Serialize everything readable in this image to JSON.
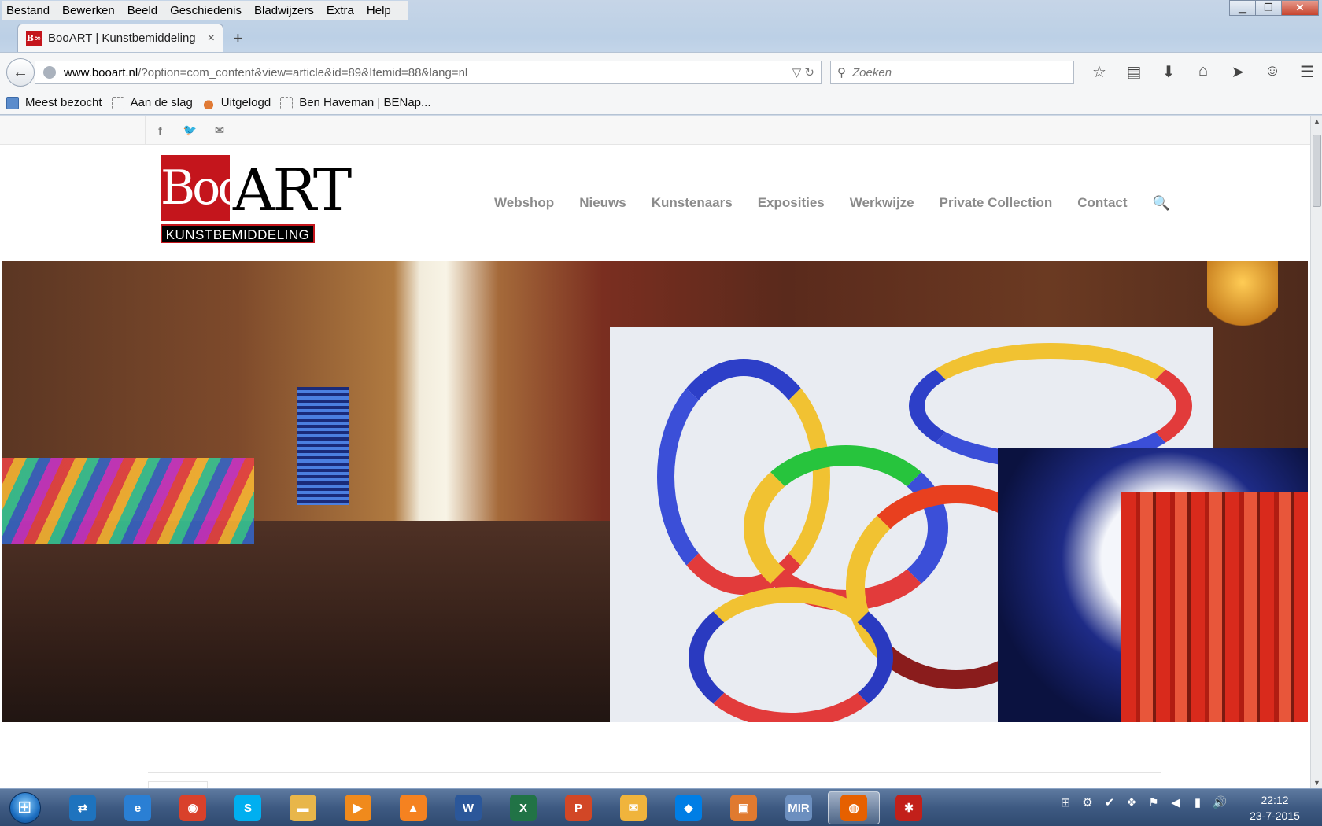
{
  "browser": {
    "menu": [
      "Bestand",
      "Bewerken",
      "Beeld",
      "Geschiedenis",
      "Bladwijzers",
      "Extra",
      "Help"
    ],
    "tab": {
      "favicon": "B∞",
      "title": "BooART | Kunstbemiddeling",
      "close": "×"
    },
    "new_tab": "+",
    "window_buttons": {
      "minimize": "▁",
      "maximize": "❐",
      "close": "✕"
    },
    "back": "←",
    "url": {
      "host": "www.booart.nl",
      "path": "/?option=com_content&view=article&id=89&Itemid=88&lang=nl"
    },
    "url_icons": "▽ ↻",
    "search": {
      "placeholder": "Zoeken",
      "icon": "search-icon"
    },
    "toolbar_icons": [
      {
        "name": "bookmark-star-icon",
        "glyph": "☆"
      },
      {
        "name": "clipboard-icon",
        "glyph": "▤"
      },
      {
        "name": "download-icon",
        "glyph": "⬇"
      },
      {
        "name": "home-icon",
        "glyph": "⌂"
      },
      {
        "name": "send-icon",
        "glyph": "➤"
      },
      {
        "name": "chat-icon",
        "glyph": "☺"
      },
      {
        "name": "menu-icon",
        "glyph": "☰"
      }
    ],
    "bookmarks": [
      "Meest bezocht",
      "Aan de slag",
      "Uitgelogd",
      "Ben Haveman | BENap..."
    ]
  },
  "site": {
    "social": [
      {
        "name": "facebook-icon",
        "glyph": "f"
      },
      {
        "name": "twitter-icon",
        "glyph": "🐦"
      },
      {
        "name": "mail-icon",
        "glyph": "✉"
      }
    ],
    "logo": {
      "boo": "Boo",
      "art": "ART",
      "tagline": "KUNSTBEMIDDELING"
    },
    "nav": [
      "Webshop",
      "Nieuws",
      "Kunstenaars",
      "Exposities",
      "Werkwijze",
      "Private Collection",
      "Contact"
    ],
    "nav_search_glyph": "🔍"
  },
  "taskbar": {
    "apps": [
      {
        "name": "teamviewer-icon",
        "glyph": "⇄",
        "color": "#1e73be"
      },
      {
        "name": "internet-explorer-icon",
        "glyph": "e",
        "color": "#2a7fd4"
      },
      {
        "name": "chrome-icon",
        "glyph": "◉",
        "color": "#d9412b"
      },
      {
        "name": "skype-icon",
        "glyph": "S",
        "color": "#00aff0"
      },
      {
        "name": "file-explorer-icon",
        "glyph": "▬",
        "color": "#e8b64a"
      },
      {
        "name": "media-player-icon",
        "glyph": "▶",
        "color": "#f08a1c"
      },
      {
        "name": "vlc-icon",
        "glyph": "▲",
        "color": "#f58220"
      },
      {
        "name": "word-icon",
        "glyph": "W",
        "color": "#2b579a"
      },
      {
        "name": "excel-icon",
        "glyph": "X",
        "color": "#217346"
      },
      {
        "name": "powerpoint-icon",
        "glyph": "P",
        "color": "#d24726"
      },
      {
        "name": "outlook-icon",
        "glyph": "✉",
        "color": "#f0b43c"
      },
      {
        "name": "dropbox-icon",
        "glyph": "◆",
        "color": "#007ee5"
      },
      {
        "name": "gallery-icon",
        "glyph": "▣",
        "color": "#e07a2f"
      },
      {
        "name": "mir-icon",
        "glyph": "MIR",
        "color": "#6c8fbf"
      },
      {
        "name": "firefox-icon",
        "glyph": "◍",
        "color": "#e66000"
      },
      {
        "name": "paint-splat-icon",
        "glyph": "✱",
        "color": "#c2201a"
      }
    ],
    "tray_glyphs": [
      "⊞",
      "⚙",
      "✔",
      "❖",
      "⚑",
      "◀",
      "▮",
      "🔊"
    ],
    "time": "22:12",
    "date": "23-7-2015"
  }
}
